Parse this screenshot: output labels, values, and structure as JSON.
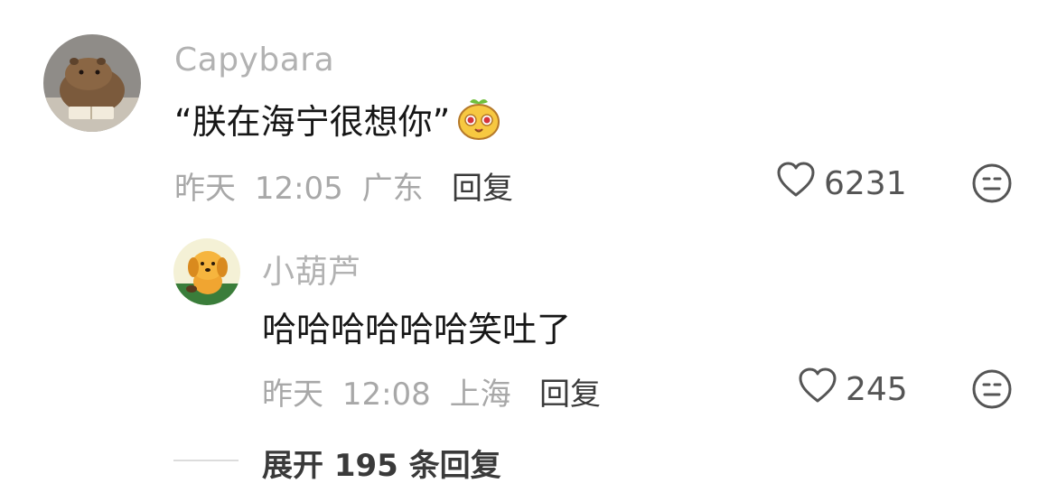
{
  "comments": [
    {
      "username": "Capybara",
      "text": "“朕在海宁很想你”",
      "emoji_icon": "cute-bun-emoji",
      "date": "昨天",
      "time": "12:05",
      "location": "广东",
      "reply_label": "回复",
      "like_icon": "heart-outline-icon",
      "likes": "6231",
      "more_icon": "meh-face-icon",
      "avatar_icon": "capybara-avatar"
    },
    {
      "username": "小葫芦",
      "text": "哈哈哈哈哈哈笑吐了",
      "date": "昨天",
      "time": "12:08",
      "location": "上海",
      "reply_label": "回复",
      "like_icon": "heart-outline-icon",
      "likes": "245",
      "more_icon": "meh-face-icon",
      "avatar_icon": "cartoon-dog-avatar"
    }
  ],
  "expand": {
    "label": "展开 195 条回复"
  },
  "colors": {
    "username": "#b2b2b2",
    "meta": "#a8a8a8",
    "text": "#161616",
    "reply": "#3a3a3a"
  }
}
